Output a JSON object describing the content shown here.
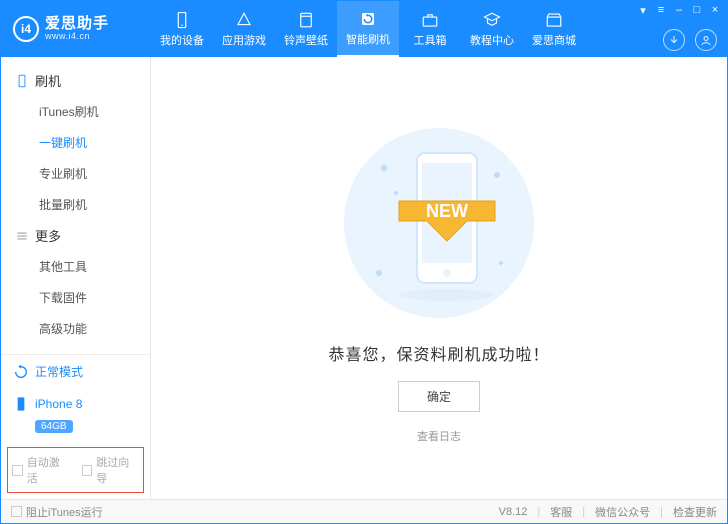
{
  "brand": {
    "logo": "i4",
    "title": "爱思助手",
    "sub": "www.i4.cn"
  },
  "topnav": [
    {
      "label": "我的设备",
      "icon": "device"
    },
    {
      "label": "应用游戏",
      "icon": "apps"
    },
    {
      "label": "铃声壁纸",
      "icon": "ringtone"
    },
    {
      "label": "智能刷机",
      "icon": "flash",
      "active": true
    },
    {
      "label": "工具箱",
      "icon": "toolbox"
    },
    {
      "label": "教程中心",
      "icon": "tutorial"
    },
    {
      "label": "爱思商城",
      "icon": "store"
    }
  ],
  "sidebar": {
    "flash_header": "刷机",
    "flash_items": [
      {
        "label": "iTunes刷机"
      },
      {
        "label": "一键刷机",
        "active": true
      },
      {
        "label": "专业刷机"
      },
      {
        "label": "批量刷机"
      }
    ],
    "more_header": "更多",
    "more_items": [
      {
        "label": "其他工具"
      },
      {
        "label": "下载固件"
      },
      {
        "label": "高级功能"
      }
    ],
    "mode": "正常模式",
    "device": "iPhone 8",
    "storage": "64GB",
    "opt_auto_activate": "自动激活",
    "opt_skip_guide": "跳过向导"
  },
  "main": {
    "new_ribbon": "NEW",
    "success_text": "恭喜您，保资料刷机成功啦！",
    "ok_btn": "确定",
    "view_log": "查看日志"
  },
  "footer": {
    "block_itunes": "阻止iTunes运行",
    "version": "V8.12",
    "support": "客服",
    "wechat": "微信公众号",
    "check_update": "检查更新"
  }
}
